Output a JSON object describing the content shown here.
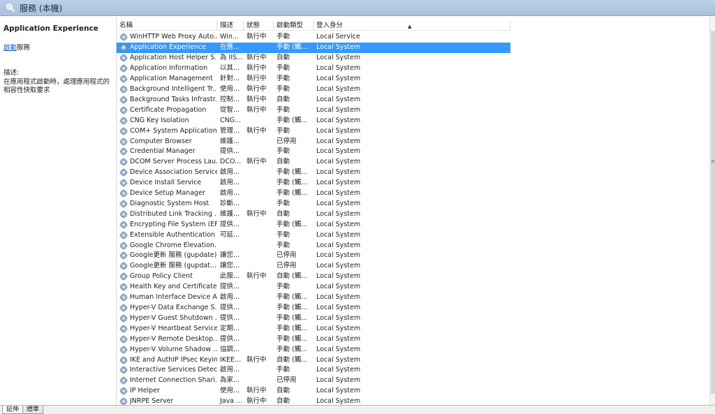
{
  "header": {
    "title": "服務 (本機)",
    "icon": "magnifier-icon"
  },
  "left_pane": {
    "service_name": "Application Experience",
    "action_link": "啟動",
    "action_suffix": "服務",
    "description_label": "描述:",
    "description_text": "在應用程式啟動時，處理應用程式的相容性快取要求"
  },
  "columns": {
    "name": "名稱",
    "desc": "描述",
    "status": "狀態",
    "startup": "啟動類型",
    "logon": "登入身分"
  },
  "rows": [
    {
      "name": "WinHTTP Web Proxy Auto...",
      "desc": "Win...",
      "status": "執行中",
      "startup": "手動",
      "logon": "Local Service"
    },
    {
      "name": "Application Experience",
      "desc": "在應...",
      "status": "",
      "startup": "手動 (觸...",
      "logon": "Local System"
    },
    {
      "name": "Application Host Helper S...",
      "desc": "為 IIS...",
      "status": "執行中",
      "startup": "自動",
      "logon": "Local System"
    },
    {
      "name": "Application Information",
      "desc": "以其...",
      "status": "執行中",
      "startup": "手動",
      "logon": "Local System"
    },
    {
      "name": "Application Management",
      "desc": "針對...",
      "status": "執行中",
      "startup": "手動",
      "logon": "Local System"
    },
    {
      "name": "Background Intelligent Tr...",
      "desc": "使用...",
      "status": "執行中",
      "startup": "手動",
      "logon": "Local System"
    },
    {
      "name": "Background Tasks Infrastr...",
      "desc": "控制...",
      "status": "執行中",
      "startup": "自動",
      "logon": "Local System"
    },
    {
      "name": "Certificate Propagation",
      "desc": "從智...",
      "status": "執行中",
      "startup": "手動",
      "logon": "Local System"
    },
    {
      "name": "CNG Key Isolation",
      "desc": "CNG...",
      "status": "",
      "startup": "手動 (觸...",
      "logon": "Local System"
    },
    {
      "name": "COM+ System Application",
      "desc": "管理...",
      "status": "執行中",
      "startup": "手動",
      "logon": "Local System"
    },
    {
      "name": "Computer Browser",
      "desc": "維護...",
      "status": "",
      "startup": "已停用",
      "logon": "Local System"
    },
    {
      "name": "Credential Manager",
      "desc": "提供...",
      "status": "",
      "startup": "手動",
      "logon": "Local System"
    },
    {
      "name": "DCOM Server Process Lau...",
      "desc": "DCO...",
      "status": "執行中",
      "startup": "自動",
      "logon": "Local System"
    },
    {
      "name": "Device Association Service",
      "desc": "啟用...",
      "status": "",
      "startup": "手動 (觸...",
      "logon": "Local System"
    },
    {
      "name": "Device Install Service",
      "desc": "啟用...",
      "status": "",
      "startup": "手動 (觸...",
      "logon": "Local System"
    },
    {
      "name": "Device Setup Manager",
      "desc": "啟用...",
      "status": "",
      "startup": "手動 (觸...",
      "logon": "Local System"
    },
    {
      "name": "Diagnostic System Host",
      "desc": "診斷...",
      "status": "",
      "startup": "手動",
      "logon": "Local System"
    },
    {
      "name": "Distributed Link Tracking ...",
      "desc": "維護...",
      "status": "執行中",
      "startup": "自動",
      "logon": "Local System"
    },
    {
      "name": "Encrypting File System (EFS)",
      "desc": "提供...",
      "status": "",
      "startup": "手動 (觸...",
      "logon": "Local System"
    },
    {
      "name": "Extensible Authentication ...",
      "desc": "可延...",
      "status": "",
      "startup": "手動",
      "logon": "Local System"
    },
    {
      "name": "Google Chrome Elevation...",
      "desc": "",
      "status": "",
      "startup": "手動",
      "logon": "Local System"
    },
    {
      "name": "Google更新 服務 (gupdate)",
      "desc": "讓您...",
      "status": "",
      "startup": "已停用",
      "logon": "Local System"
    },
    {
      "name": "Google更新 服務 (gupdat...",
      "desc": "讓您...",
      "status": "",
      "startup": "已停用",
      "logon": "Local System"
    },
    {
      "name": "Group Policy Client",
      "desc": "此服...",
      "status": "執行中",
      "startup": "自動 (觸...",
      "logon": "Local System"
    },
    {
      "name": "Health Key and Certificate...",
      "desc": "提供...",
      "status": "",
      "startup": "手動",
      "logon": "Local System"
    },
    {
      "name": "Human Interface Device A...",
      "desc": "啟用...",
      "status": "",
      "startup": "手動 (觸...",
      "logon": "Local System"
    },
    {
      "name": "Hyper-V Data Exchange S...",
      "desc": "提供...",
      "status": "",
      "startup": "手動 (觸...",
      "logon": "Local System"
    },
    {
      "name": "Hyper-V Guest Shutdown ...",
      "desc": "提供...",
      "status": "",
      "startup": "手動 (觸...",
      "logon": "Local System"
    },
    {
      "name": "Hyper-V Heartbeat Service",
      "desc": "定期...",
      "status": "",
      "startup": "手動 (觸...",
      "logon": "Local System"
    },
    {
      "name": "Hyper-V Remote Desktop...",
      "desc": "提供...",
      "status": "",
      "startup": "手動 (觸...",
      "logon": "Local System"
    },
    {
      "name": "Hyper-V Volume Shadow ...",
      "desc": "協調...",
      "status": "",
      "startup": "手動 (觸...",
      "logon": "Local System"
    },
    {
      "name": "IKE and AuthIP IPsec Keyin...",
      "desc": "IKEE...",
      "status": "執行中",
      "startup": "自動 (觸...",
      "logon": "Local System"
    },
    {
      "name": "Interactive Services Detect...",
      "desc": "啟用...",
      "status": "",
      "startup": "手動",
      "logon": "Local System"
    },
    {
      "name": "Internet Connection Shari...",
      "desc": "為家...",
      "status": "",
      "startup": "已停用",
      "logon": "Local System"
    },
    {
      "name": "IP Helper",
      "desc": "使用...",
      "status": "執行中",
      "startup": "自動",
      "logon": "Local System"
    },
    {
      "name": "JNRPE Server",
      "desc": "Java ...",
      "status": "執行中",
      "startup": "自動",
      "logon": "Local System"
    }
  ],
  "selected_index": 1,
  "tabs": [
    {
      "label": "延伸",
      "active": true
    },
    {
      "label": "標準",
      "active": false
    }
  ],
  "colors": {
    "selection": "#3399ff",
    "header_bar": "#bcd0e6",
    "link": "#1a56c8"
  }
}
